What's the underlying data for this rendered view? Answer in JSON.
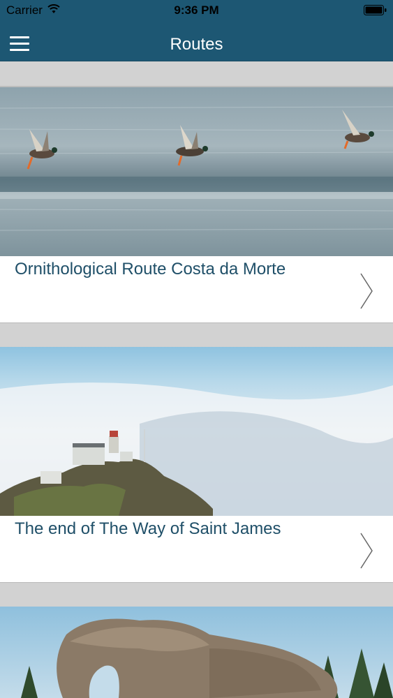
{
  "status_bar": {
    "carrier": "Carrier",
    "time": "9:36 PM"
  },
  "nav": {
    "title": "Routes"
  },
  "routes": [
    {
      "label": "Ornithological Route Costa da Morte",
      "image": "ducks-over-sea"
    },
    {
      "label": "The end of The Way of Saint James",
      "image": "lighthouse-above-fog"
    },
    {
      "label": "",
      "image": "rock-formation"
    }
  ],
  "colors": {
    "nav_background": "#1d5773",
    "label_text": "#1f4f68",
    "separator_background": "#d2d2d2"
  }
}
